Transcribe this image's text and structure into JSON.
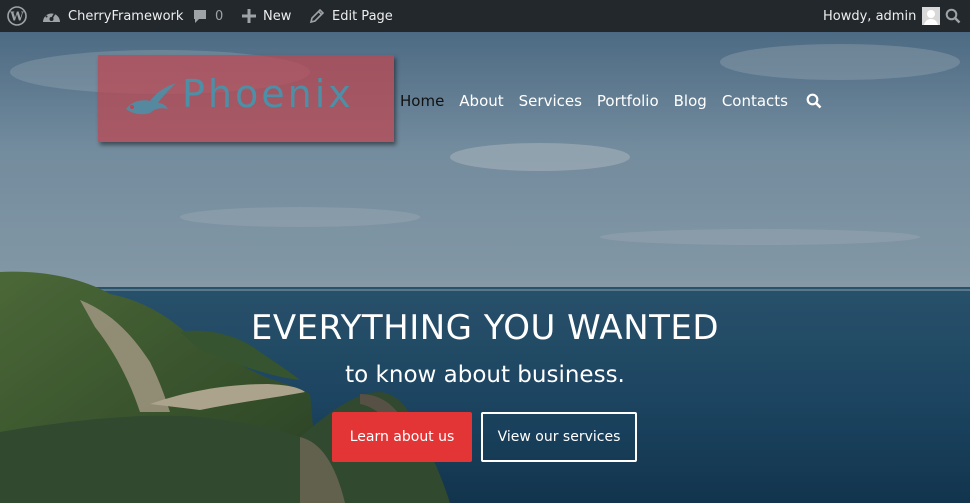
{
  "adminbar": {
    "wp_icon": "wordpress-icon",
    "site_name": "CherryFramework",
    "comments_count": "0",
    "new_label": "New",
    "edit_label": "Edit Page",
    "howdy": "Howdy, admin",
    "search_icon": "search-icon",
    "bg_color": "#23282d"
  },
  "logo": {
    "text": "Phoenix",
    "bg_color": "#be4650",
    "text_color": "#4d8fa6"
  },
  "nav": {
    "items": [
      {
        "label": "Home",
        "active": true
      },
      {
        "label": "About"
      },
      {
        "label": "Services"
      },
      {
        "label": "Portfolio"
      },
      {
        "label": "Blog"
      },
      {
        "label": "Contacts"
      }
    ],
    "search_icon": "search-icon"
  },
  "hero": {
    "title": "EVERYTHING YOU WANTED",
    "subtitle": "to know about business.",
    "primary_button": "Learn about us",
    "secondary_button": "View our services",
    "primary_color": "#e33535"
  }
}
